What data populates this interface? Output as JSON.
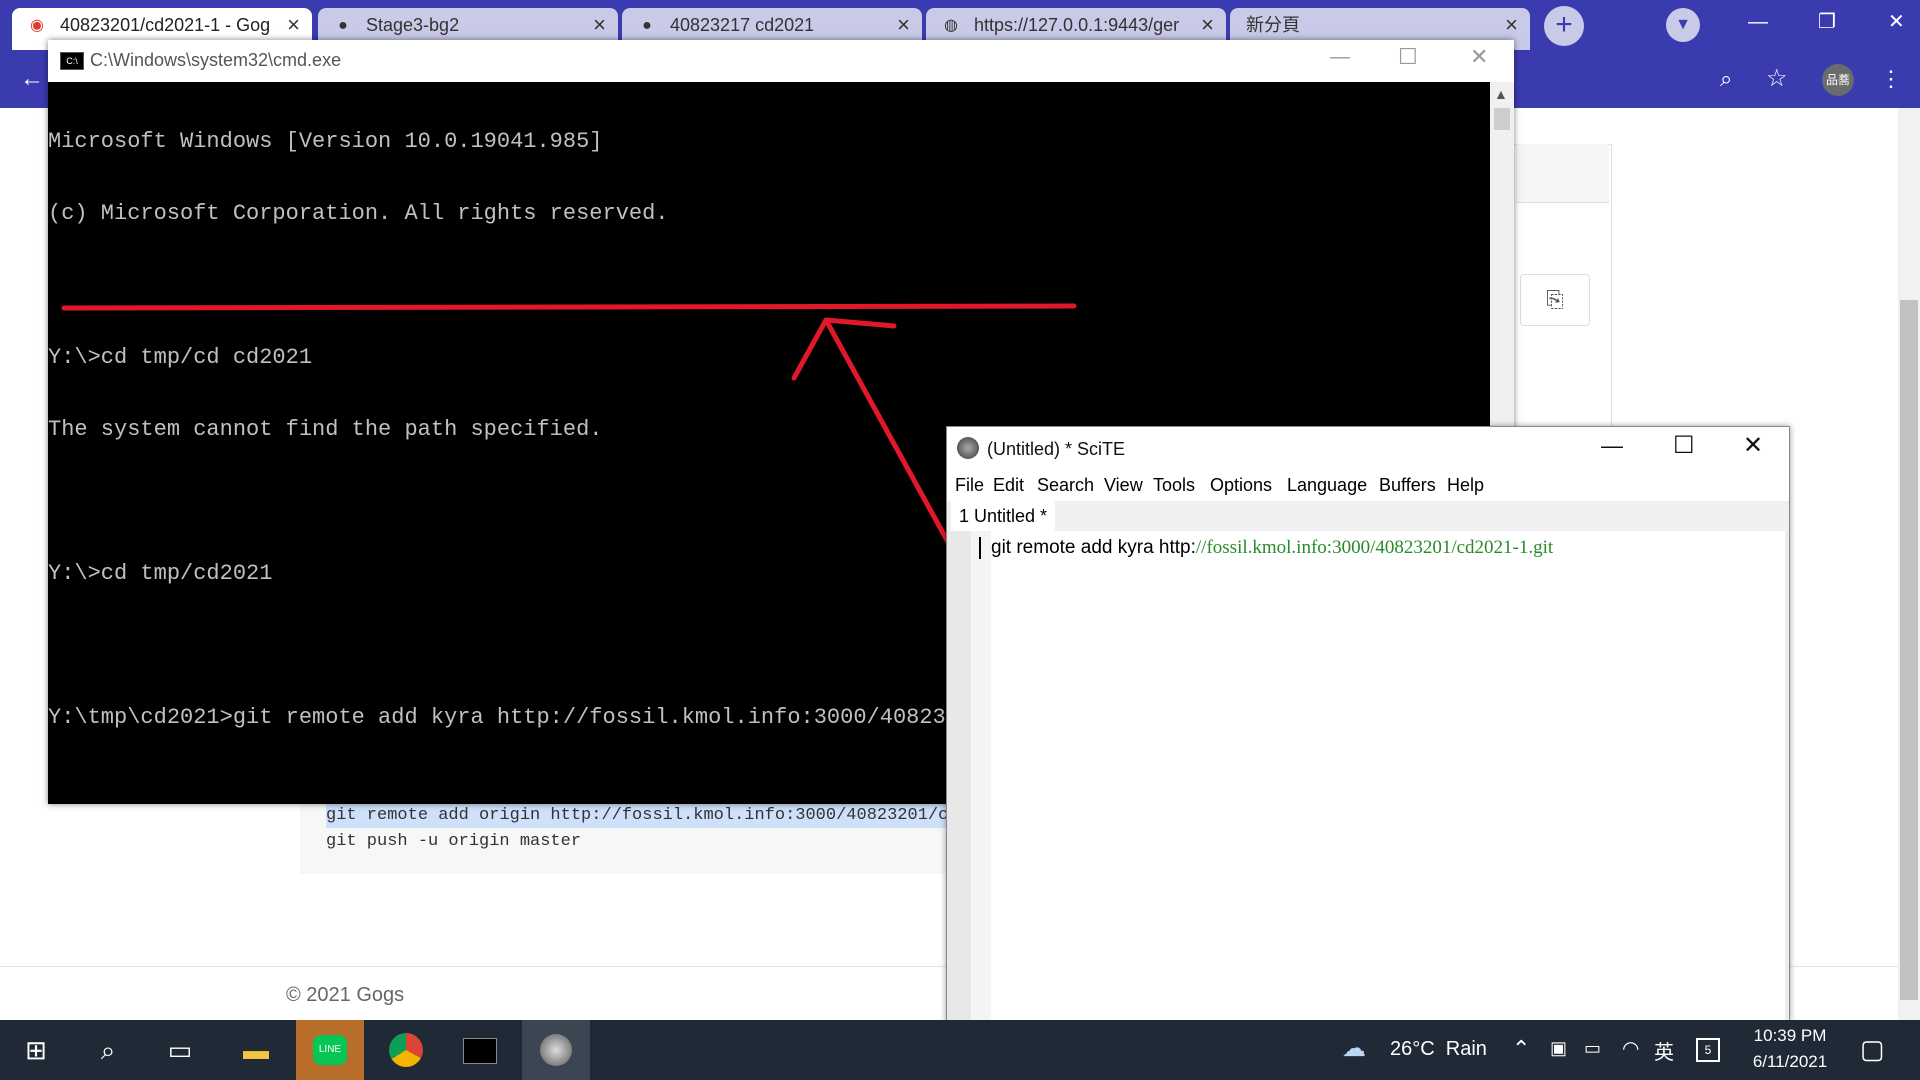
{
  "browser": {
    "tabs": [
      {
        "label": "40823201/cd2021-1 - Gog",
        "icon": "gogs-icon"
      },
      {
        "label": "Stage3-bg2",
        "icon": "github-icon"
      },
      {
        "label": "40823217 cd2021",
        "icon": "github-icon"
      },
      {
        "label": "https://127.0.0.1:9443/ger",
        "icon": "globe-icon"
      },
      {
        "label": "新分頁",
        "icon": "none"
      }
    ],
    "profile_label": "品蕎",
    "page": {
      "code_lines": [
        "git remote add origin http://fossil.kmol.info:3000/40823201/cd",
        "git push -u origin master"
      ],
      "footer": "© 2021 Gogs"
    }
  },
  "cmd": {
    "title": "C:\\Windows\\system32\\cmd.exe",
    "lines": [
      "Microsoft Windows [Version 10.0.19041.985]",
      "(c) Microsoft Corporation. All rights reserved.",
      "",
      "Y:\\>cd tmp/cd cd2021",
      "The system cannot find the path specified.",
      "",
      "Y:\\>cd tmp/cd2021",
      "",
      "Y:\\tmp\\cd2021>git remote add kyra http://fossil.kmol.info:3000/40823201/cd2021-1.git"
    ]
  },
  "annotation": {
    "color": "#e0182a"
  },
  "scite": {
    "title": "(Untitled) * SciTE",
    "menu": [
      "File",
      "Edit",
      "Search",
      "View",
      "Tools",
      "Options",
      "Language",
      "Buffers",
      "Help"
    ],
    "tab": "1 Untitled *",
    "code_prefix": "git remote add kyra http:",
    "code_url": "//fossil.kmol.info:3000/40823201/cd2021-1.git",
    "url_color": "#2a8a2a"
  },
  "taskbar": {
    "weather": "26°C  Rain",
    "ime": "英",
    "time": "10:39 PM",
    "date": "6/11/2021"
  }
}
